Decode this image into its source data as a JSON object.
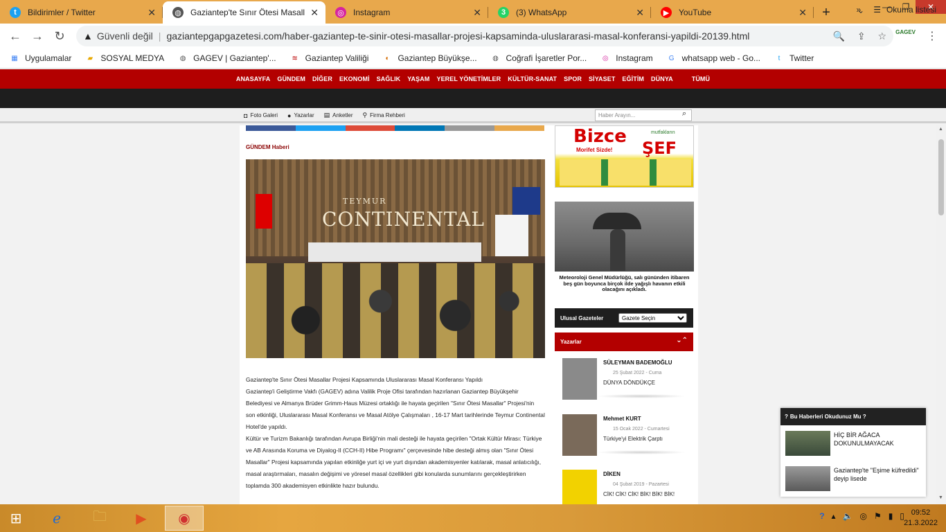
{
  "browser": {
    "tabs": [
      {
        "title": "Bildirimler / Twitter",
        "icon": "twitter-icon",
        "color": "#1da1f2",
        "active": false
      },
      {
        "title": "Gaziantep'te Sınır Ötesi Masall",
        "icon": "globe-icon",
        "color": "#555555",
        "active": true
      },
      {
        "title": "Instagram",
        "icon": "instagram-icon",
        "color": "#d6249f",
        "active": false
      },
      {
        "title": "(3) WhatsApp",
        "icon": "whatsapp-icon",
        "color": "#25d366",
        "active": false
      },
      {
        "title": "YouTube",
        "icon": "youtube-icon",
        "color": "#ff0000",
        "active": false
      }
    ],
    "whatsapp_badge": "3",
    "address": {
      "security_label": "Güvenli değil",
      "url": "gaziantepgapgazetesi.com/haber-gaziantep-te-sinir-otesi-masallar-projesi-kapsaminda-uluslararasi-masal-konferansi-yapildi-20139.html"
    },
    "extension_label": "GAGEV",
    "bookmarks": [
      {
        "label": "Uygulamalar",
        "icon": "apps-grid-icon"
      },
      {
        "label": "SOSYAL MEDYA",
        "icon": "folder-icon"
      },
      {
        "label": "GAGEV | Gaziantep'...",
        "icon": "globe-icon"
      },
      {
        "label": "Gaziantep Valiliği",
        "icon": "valilik-icon"
      },
      {
        "label": "Gaziantep Büyükşe...",
        "icon": "buyuksehir-icon"
      },
      {
        "label": "Coğrafi İşaretler Por...",
        "icon": "globe-icon"
      },
      {
        "label": "Instagram",
        "icon": "instagram-icon"
      },
      {
        "label": "whatsapp web - Go...",
        "icon": "google-icon"
      },
      {
        "label": "Twitter",
        "icon": "twitter-icon"
      }
    ],
    "reading_list": "Okuma listesi"
  },
  "site": {
    "nav": [
      "ANASAYFA",
      "GÜNDEM",
      "DİĞER",
      "EKONOMİ",
      "SAĞLIK",
      "YAŞAM",
      "YEREL YÖNETİMLER",
      "KÜLTÜR-SANAT",
      "SPOR",
      "SİYASET",
      "EĞİTİM",
      "DÜNYA",
      "TÜMÜ"
    ],
    "subnav": [
      {
        "label": "Foto Galeri",
        "icon": "camera-icon"
      },
      {
        "label": "Yazarlar",
        "icon": "person-icon"
      },
      {
        "label": "Anketler",
        "icon": "poll-icon"
      },
      {
        "label": "Firma Rehberi",
        "icon": "map-pin-icon"
      }
    ],
    "search_placeholder": "Haber Arayın..."
  },
  "article": {
    "category": "GÜNDEM Haberi",
    "hero_text_small": "TEYMUR",
    "hero_text_big": "CONTINENTAL",
    "paragraphs": [
      "Gaziantep'te Sınır Ötesi Masallar Projesi Kapsamında Uluslararası Masal Konferansı Yapıldı",
      "Gaziantep'i Geliştirme Vakfı (GAGEV) adına Valilik Proje Ofisi tarafından hazırlanan Gaziantep Büyükşehir Belediyesi ve Almanya Brüder Grimm-Haus Müzesi ortaklığı ile hayata geçirilen \"Sınır Ötesi Masallar\" Projesi'nin son etkinliği, Uluslararası Masal Konferansı ve Masal Atölye Çalışmaları , 16-17 Mart tarihlerinde Teymur Continental Hotel'de yapıldı.",
      "Kültür ve Turizm Bakanlığı tarafından Avrupa Birliği'nin mali desteği ile hayata geçirilen \"Ortak Kültür Mirası: Türkiye ve AB Arasında Koruma ve Diyalog-II (CCH-II) Hibe Programı\" çerçevesinde hibe desteği almış olan \"Sınır Ötesi Masallar\" Projesi kapsamında yapılan etkinliğe yurt içi ve yurt dışından akademisyenler katılarak, masal anlatıcılığı, masal araştırmaları, masalın değişimi ve yöresel masal özellikleri gibi konularda sunumlarını gerçekleştirirken toplamda 300 akademisyen etkinlikte hazır bulundu."
    ],
    "share_colors": [
      "#3b5998",
      "#1da1f2",
      "#dd4b39",
      "#0077b5",
      "#999999",
      "#e8a84c"
    ]
  },
  "sidebar": {
    "ad": {
      "brand1": "Bizce",
      "slogan": "Morifet Sizde!",
      "brand2": "ŞEF",
      "tag": "mutfakların"
    },
    "weather_caption": "Meteoroloji Genel Müdürlüğü, salı gününden itibaren beş gün boyunca birçok ilde yağışlı havanın etkili olacağını açıkladı.",
    "ulusal_label": "Ulusal Gazeteler",
    "ulusal_select": "Gazete Seçin",
    "yazarlar_label": "Yazarlar",
    "writers": [
      {
        "name": "SÜLEYMAN BADEMOĞLU",
        "date": "25 Şubat 2022 - Cuma",
        "title": "DÜNYA DÖNDÜKÇE",
        "avatar_color": "#8a8a8a"
      },
      {
        "name": "Mehmet KURT",
        "date": "15 Ocak 2022 - Cumartesi",
        "title": "Türkiye'yi Elektrik Çarptı",
        "avatar_color": "#7a6a5a"
      },
      {
        "name": "DİKEN",
        "date": "04 Şubat 2019 - Pazartesi",
        "title": "CİK! CİK! CİK! BİK! BİK! BİK!",
        "avatar_color": "#f2d200"
      }
    ]
  },
  "popup": {
    "header": "Bu Haberleri Okudunuz Mu ?",
    "items": [
      {
        "title": "HİÇ BİR AĞACA DOKUNULMAYACAK"
      },
      {
        "title": "Gaziantep'te \"Eşime küfredildi\" deyip lisede"
      }
    ]
  },
  "taskbar": {
    "time": "09:52",
    "date": "21.3.2022"
  }
}
